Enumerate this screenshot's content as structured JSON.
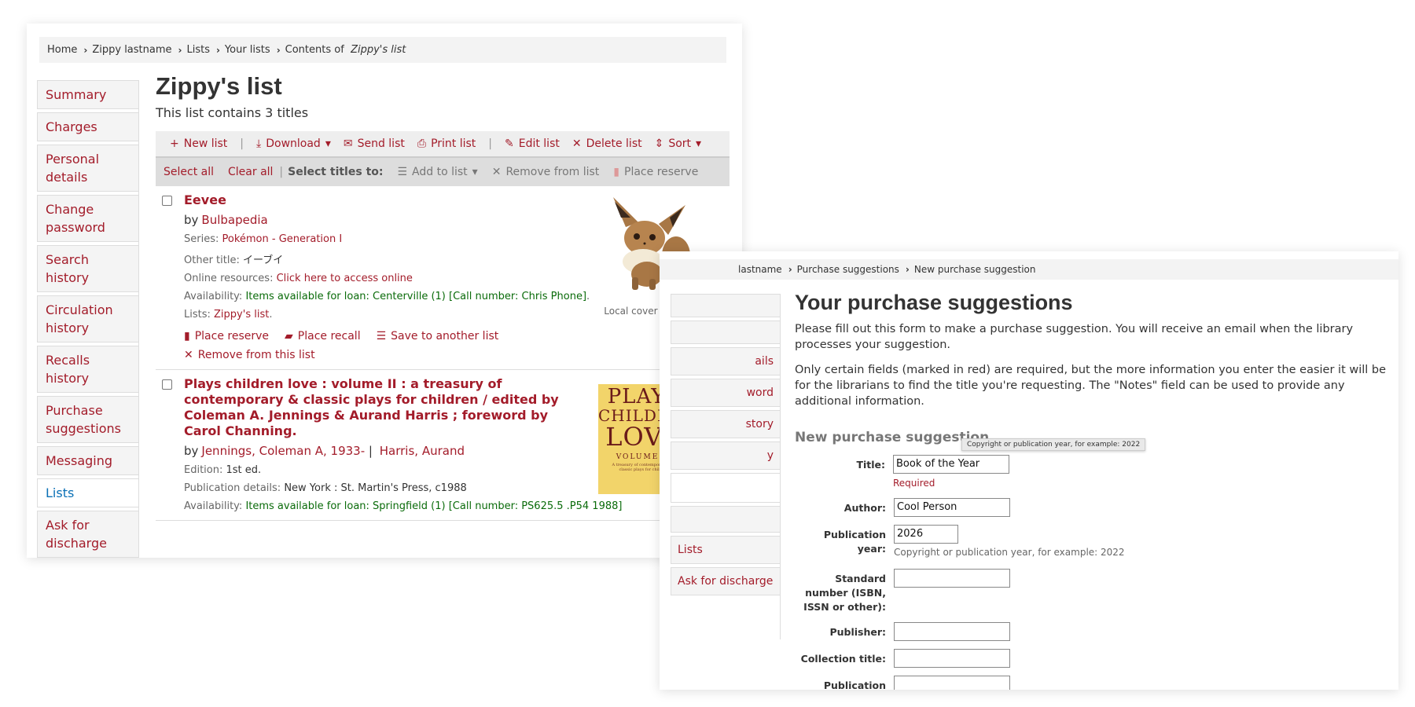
{
  "list_window": {
    "breadcrumb": {
      "home": "Home",
      "user": "Zippy lastname",
      "lists": "Lists",
      "your_lists": "Your lists",
      "contents_prefix": "Contents of ",
      "contents_name": "Zippy's list"
    },
    "sidebar": [
      "Summary",
      "Charges",
      "Personal details",
      "Change password",
      "Search history",
      "Circulation history",
      "Recalls history",
      "Purchase suggestions",
      "Messaging",
      "Lists",
      "Ask for discharge"
    ],
    "sidebar_active": "Lists",
    "title": "Zippy's list",
    "count": "This list contains 3 titles",
    "toolbar": {
      "new_list": "New list",
      "download": "Download",
      "send_list": "Send list",
      "print_list": "Print list",
      "edit_list": "Edit list",
      "delete_list": "Delete list",
      "sort": "Sort"
    },
    "selbar": {
      "select_all": "Select all",
      "clear_all": "Clear all",
      "select_titles": "Select titles to:",
      "add_to_list": "Add to list",
      "remove_from_list": "Remove from list",
      "place_reserve": "Place reserve"
    },
    "records": [
      {
        "title": "Eevee",
        "by": "by",
        "author": "Bulbapedia",
        "series_label": "Series:",
        "series": "Pokémon - Generation I",
        "other_label": "Other title:",
        "other": "イーブイ",
        "online_label": "Online resources:",
        "online": "Click here to access online",
        "avail_label": "Availability:",
        "avail": "Items available for loan:",
        "avail_loc": "Centerville (1) [Call number: Chris Phone]",
        "avail_end": ".",
        "lists_label": "Lists:",
        "lists": "Zippy's list",
        "lists_end": ".",
        "actions": {
          "place_reserve": "Place reserve",
          "place_recall": "Place recall",
          "save_to_list": "Save to another list",
          "remove": "Remove from this list"
        },
        "cover_caption": "Local cover image"
      },
      {
        "title": "Plays children love : volume II : a treasury of contemporary & classic plays for children / edited by Coleman A. Jennings & Aurand Harris ; foreword by Carol Channing.",
        "by": "by",
        "author": "Jennings, Coleman A, 1933-",
        "author_sep": "|",
        "author2": "Harris, Aurand",
        "edition_label": "Edition:",
        "edition": "1st ed.",
        "pub_label": "Publication details:",
        "pub": "New York : St. Martin's Press, c1988",
        "avail_label": "Availability:",
        "avail": "Items available for loan:",
        "avail_loc": "Springfield (1) [Call number: PS625.5 .P54 1988]",
        "cover_text": [
          "PLAYS",
          "CHILDREN",
          "LOVE"
        ],
        "cover_vol": "VOLUME II",
        "cover_sub": "A treasury of contemporary and classic plays for children"
      }
    ]
  },
  "suggest_window": {
    "breadcrumb": {
      "user": "lastname",
      "purchase": "Purchase suggestions",
      "new": "New purchase suggestion"
    },
    "sidebar": [
      "",
      "",
      "ails",
      "word",
      "story",
      "y",
      "",
      "",
      "Lists",
      "Ask for discharge"
    ],
    "title": "Your purchase suggestions",
    "intro": "Please fill out this form to make a purchase suggestion. You will receive an email when the library processes your suggestion.",
    "note": "Only certain fields (marked in red) are required, but the more information you enter the easier it will be for the librarians to find the title you're requesting. The \"Notes\" field can be used to provide any additional information.",
    "tooltip": "Copyright or publication year, for example: 2022",
    "section": "New purchase suggestion",
    "fields": {
      "title": {
        "label": "Title:",
        "value": "Book of the Year",
        "required": "Required"
      },
      "author": {
        "label": "Author:",
        "value": "Cool Person"
      },
      "pubyear": {
        "label": "Publication year:",
        "value": "2026",
        "hint": "Copyright or publication year, for example: 2022"
      },
      "isbn": {
        "label": "Standard number (ISBN, ISSN or other):",
        "value": ""
      },
      "publisher": {
        "label": "Publisher:",
        "value": ""
      },
      "collection": {
        "label": "Collection title:",
        "value": ""
      },
      "place": {
        "label": "Publication place:",
        "value": ""
      }
    }
  },
  "colors": {
    "link": "#a31c2a",
    "active": "#0a70b6",
    "available": "#0a6b0a"
  }
}
